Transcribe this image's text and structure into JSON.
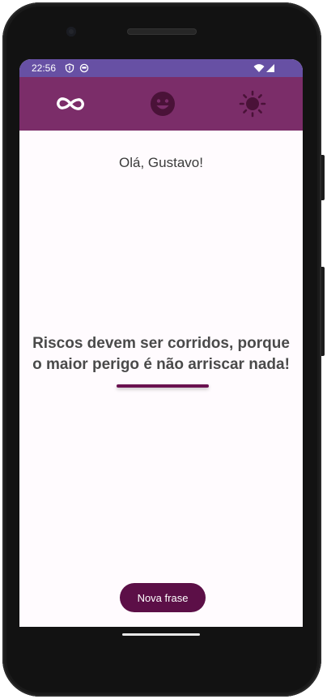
{
  "status_bar": {
    "time": "22:56",
    "icons": [
      "shield-icon",
      "face-icon",
      "wifi-icon",
      "signal-icon"
    ]
  },
  "app_bar": {
    "tabs": [
      {
        "icon": "infinity-icon",
        "selected": true
      },
      {
        "icon": "smiley-icon",
        "selected": false
      },
      {
        "icon": "sun-icon",
        "selected": false
      }
    ]
  },
  "main": {
    "greeting": "Olá, Gustavo!",
    "quote": "Riscos devem ser corridos, porque o maior perigo é não arriscar nada!"
  },
  "actions": {
    "new_phrase_label": "Nova frase"
  },
  "colors": {
    "status_bar": "#6750a4",
    "app_bar": "#7b2d69",
    "accent": "#5c0f47",
    "background": "#fffbfe",
    "icon_inactive": "#4a1238",
    "icon_active": "#ffffff"
  }
}
